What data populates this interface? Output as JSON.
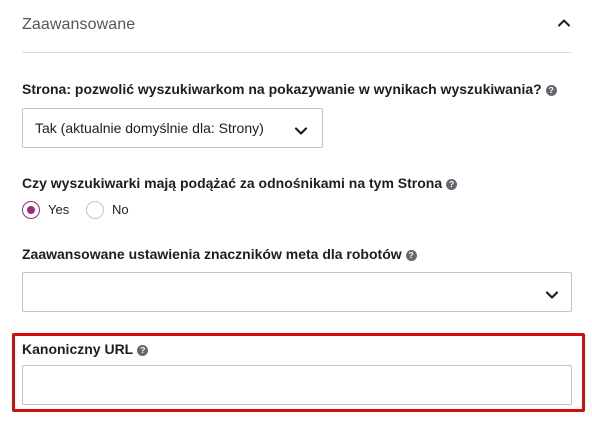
{
  "section": {
    "title": "Zaawansowane",
    "collapse_icon": "chevron-up-icon"
  },
  "fields": {
    "show_in_search": {
      "label": "Strona: pozwolić wyszukiwarkom na pokazywanie w wynikach wyszukiwania?",
      "help": "?",
      "selected": "Tak (aktualnie domyślnie dla: Strony)"
    },
    "follow_links": {
      "label": "Czy wyszukiwarki mają podążać za odnośnikami na tym Strona",
      "help": "?",
      "options": [
        {
          "label": "Yes",
          "checked": true
        },
        {
          "label": "No",
          "checked": false
        }
      ]
    },
    "robots_meta": {
      "label": "Zaawansowane ustawienia znaczników meta dla robotów",
      "help": "?",
      "selected": ""
    },
    "canonical_url": {
      "label": "Kanoniczny URL",
      "help": "?",
      "value": ""
    }
  },
  "colors": {
    "accent": "#9f2a7a",
    "highlight": "#d20d0d",
    "border": "#c3c4c7"
  }
}
